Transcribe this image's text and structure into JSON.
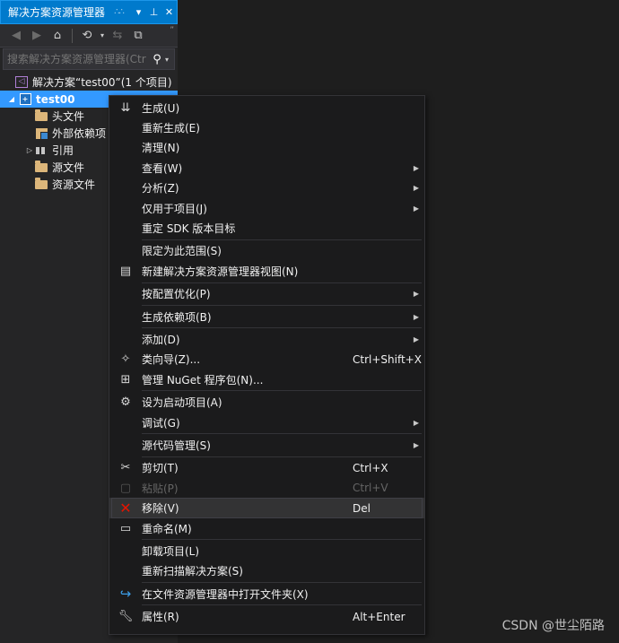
{
  "panel": {
    "title": "解决方案资源管理器",
    "search_placeholder": "搜索解决方案资源管理器(Ctr"
  },
  "tree": {
    "solution": "解决方案“test00”(1 个项目)",
    "project": "test00",
    "items": [
      {
        "label": "头文件"
      },
      {
        "label": "外部依赖项"
      },
      {
        "label": "引用"
      },
      {
        "label": "源文件"
      },
      {
        "label": "资源文件"
      }
    ]
  },
  "menu": {
    "items": [
      {
        "label": "生成(U)",
        "icon": "build-icon"
      },
      {
        "label": "重新生成(E)"
      },
      {
        "label": "清理(N)"
      },
      {
        "label": "查看(W)",
        "submenu": true
      },
      {
        "label": "分析(Z)",
        "submenu": true
      },
      {
        "label": "仅用于项目(J)",
        "submenu": true
      },
      {
        "label": "重定 SDK 版本目标"
      },
      {
        "label": "限定为此范围(S)"
      },
      {
        "label": "新建解决方案资源管理器视图(N)",
        "icon": "new-view-icon"
      },
      {
        "label": "按配置优化(P)",
        "submenu": true
      },
      {
        "label": "生成依赖项(B)",
        "submenu": true
      },
      {
        "label": "添加(D)",
        "submenu": true
      },
      {
        "label": "类向导(Z)...",
        "shortcut": "Ctrl+Shift+X",
        "icon": "class-wizard-icon"
      },
      {
        "label": "管理 NuGet 程序包(N)...",
        "icon": "nuget-icon"
      },
      {
        "label": "设为启动项目(A)",
        "icon": "gear-icon"
      },
      {
        "label": "调试(G)",
        "submenu": true
      },
      {
        "label": "源代码管理(S)",
        "submenu": true
      },
      {
        "label": "剪切(T)",
        "shortcut": "Ctrl+X",
        "icon": "scissors-icon"
      },
      {
        "label": "粘贴(P)",
        "shortcut": "Ctrl+V",
        "icon": "paste-icon",
        "disabled": true
      },
      {
        "label": "移除(V)",
        "shortcut": "Del",
        "icon": "remove-icon",
        "hover": true
      },
      {
        "label": "重命名(M)",
        "icon": "rename-icon"
      },
      {
        "label": "卸载项目(L)"
      },
      {
        "label": "重新扫描解决方案(S)"
      },
      {
        "label": "在文件资源管理器中打开文件夹(X)",
        "icon": "open-folder-icon"
      },
      {
        "label": "属性(R)",
        "shortcut": "Alt+Enter",
        "icon": "wrench-icon"
      }
    ]
  },
  "watermark": "CSDN @世尘陌路",
  "colors": {
    "accent": "#007acc",
    "selection": "#3399ff",
    "remove": "#e51400"
  }
}
